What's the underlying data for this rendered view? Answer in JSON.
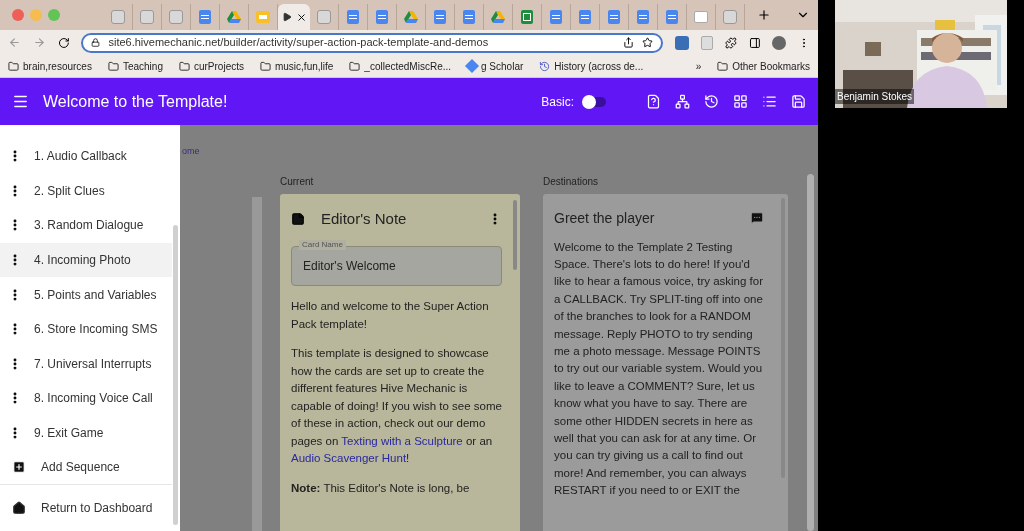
{
  "browser": {
    "tabs": [
      {
        "kind": "hive",
        "selected": false
      },
      {
        "kind": "hive",
        "selected": false
      },
      {
        "kind": "hive",
        "selected": false
      },
      {
        "kind": "doc",
        "selected": false
      },
      {
        "kind": "drive",
        "selected": false
      },
      {
        "kind": "slides",
        "selected": false
      },
      {
        "kind": "play",
        "selected": true
      },
      {
        "kind": "hive",
        "selected": false
      },
      {
        "kind": "doc",
        "selected": false
      },
      {
        "kind": "doc",
        "selected": false
      },
      {
        "kind": "drive",
        "selected": false
      },
      {
        "kind": "doc",
        "selected": false
      },
      {
        "kind": "doc",
        "selected": false
      },
      {
        "kind": "drive",
        "selected": false
      },
      {
        "kind": "sheets",
        "selected": false
      },
      {
        "kind": "doc",
        "selected": false
      },
      {
        "kind": "doc",
        "selected": false
      },
      {
        "kind": "doc",
        "selected": false
      },
      {
        "kind": "doc",
        "selected": false
      },
      {
        "kind": "doc",
        "selected": false
      },
      {
        "kind": "other",
        "selected": false
      },
      {
        "kind": "hive",
        "selected": false
      }
    ],
    "url": "site6.hivemechanic.net/builder/activity/super-action-pack-template-and-demos",
    "bookmarks": [
      {
        "kind": "folder",
        "label": "brain,resources"
      },
      {
        "kind": "folder",
        "label": "Teaching"
      },
      {
        "kind": "folder",
        "label": "curProjects"
      },
      {
        "kind": "folder",
        "label": "music,fun,life"
      },
      {
        "kind": "folder",
        "label": "_collectedMiscRe..."
      },
      {
        "kind": "scholar",
        "label": "g Scholar"
      },
      {
        "kind": "history",
        "label": "History (across de..."
      }
    ],
    "more_bookmarks": "»",
    "other_bookmarks": "Other Bookmarks"
  },
  "app_bar": {
    "title": "Welcome to the Template!",
    "toggle_label": "Basic:",
    "basic_on": false
  },
  "sidebar": {
    "items": [
      {
        "label": "1. Audio Callback",
        "selected": false
      },
      {
        "label": "2. Split Clues",
        "selected": false
      },
      {
        "label": "3. Random Dialogue",
        "selected": false
      },
      {
        "label": "4. Incoming Photo",
        "selected": true
      },
      {
        "label": "5. Points and Variables",
        "selected": false
      },
      {
        "label": "6. Store Incoming SMS",
        "selected": false
      },
      {
        "label": "7. Universal Interrupts",
        "selected": false
      },
      {
        "label": "8. Incoming Voice Call",
        "selected": false
      },
      {
        "label": "9. Exit Game",
        "selected": false
      }
    ],
    "add_label": "Add Sequence",
    "dashboard_label": "Return to Dashboard"
  },
  "breadcrumb": "ome",
  "current": {
    "heading": "Current",
    "card": {
      "title": "Editor's Note",
      "field_label": "Card Name",
      "field_value": "Editor's Welcome",
      "paragraphs": [
        [
          {
            "text": "Hello and welcome to the Super Action Pack template!",
            "kind": "text"
          }
        ],
        [
          {
            "text": "This template is designed to showcase how the cards are set up to create the different features Hive Mechanic is capable of doing! If you wish to see some of these in action, check out our demo pages on ",
            "kind": "text"
          },
          {
            "text": "Texting with a Sculpture",
            "kind": "link"
          },
          {
            "text": " or an ",
            "kind": "text"
          },
          {
            "text": "Audio Scavenger Hunt",
            "kind": "link"
          },
          {
            "text": "!",
            "kind": "text"
          }
        ],
        [
          {
            "text": "**Note:** This Editor's Note is long, be",
            "kind": "text"
          }
        ]
      ]
    }
  },
  "destinations": {
    "heading": "Destinations",
    "card": {
      "title": "Greet the player",
      "body": "Welcome to the Template 2 Testing Space. There's lots to do here! If you'd like to hear a famous voice, try asking for a CALLBACK. Try SPLIT-ting off into one of the branches to look for a RANDOM message. Reply PHOTO to try sending me a photo message. Message POINTS to try out our variable system. Would you like to leave a COMMENT? Sure, let us know what you have to say. There are some other HIDDEN secrets in here as well that you can ask for at any time. Or you can try giving us a call to find out more! And remember, you can always RESTART if you need to or EXIT the"
    }
  },
  "video": {
    "kind": "picture",
    "name": "Benjamin Stokes"
  }
}
